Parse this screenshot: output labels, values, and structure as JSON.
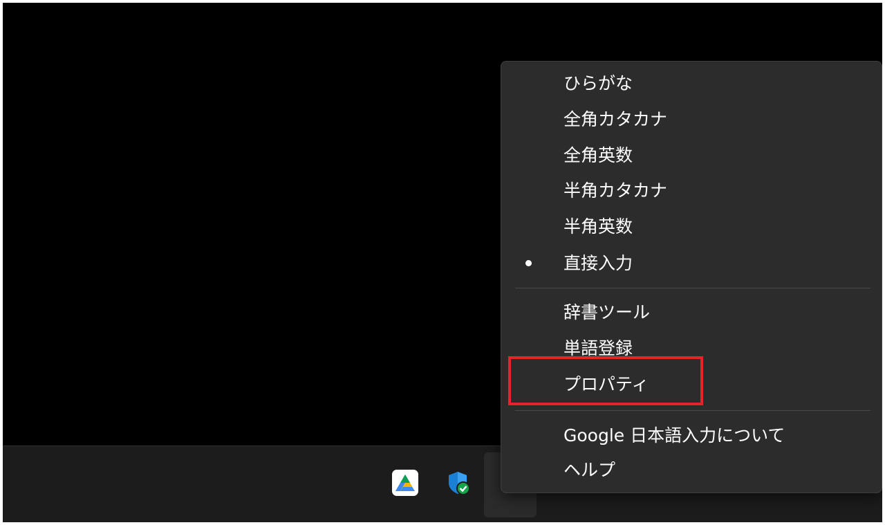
{
  "context_menu": {
    "items": [
      {
        "label": "ひらがな",
        "checked": false
      },
      {
        "label": "全角カタカナ",
        "checked": false
      },
      {
        "label": "全角英数",
        "checked": false
      },
      {
        "label": "半角カタカナ",
        "checked": false
      },
      {
        "label": "半角英数",
        "checked": false
      },
      {
        "label": "直接入力",
        "checked": true
      },
      {
        "label": "辞書ツール",
        "checked": false
      },
      {
        "label": "単語登録",
        "checked": false
      },
      {
        "label": "プロパティ",
        "checked": false,
        "annotated": true
      },
      {
        "label": "Google 日本語入力について",
        "checked": false
      },
      {
        "label": "ヘルプ",
        "checked": false
      }
    ]
  },
  "taskbar": {
    "tray_icons": [
      "google-drive-icon",
      "windows-security-icon",
      "ime-icon"
    ]
  },
  "colors": {
    "annotation": "#e4242b",
    "menu_background": "#2c2c2c",
    "taskbar_background": "#1c1c1c"
  }
}
